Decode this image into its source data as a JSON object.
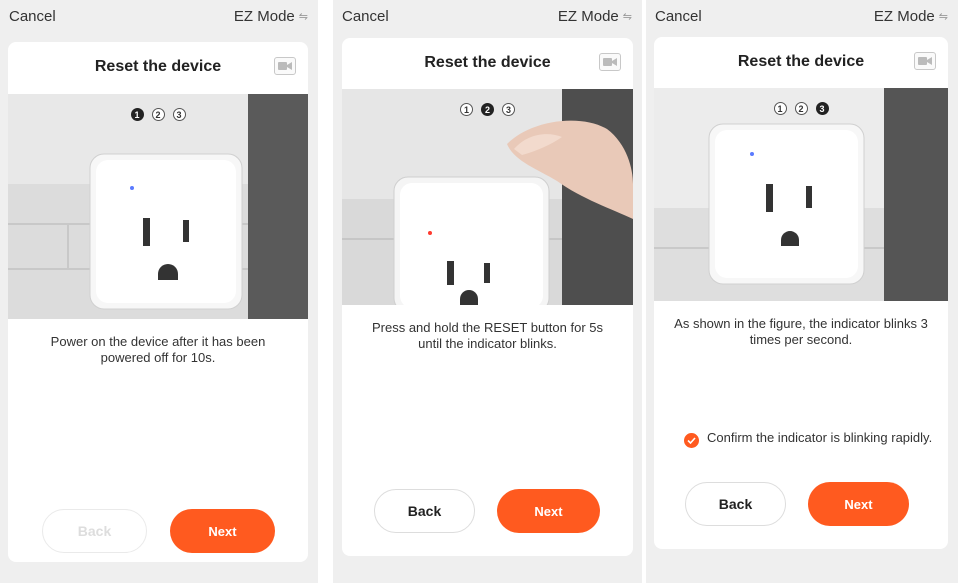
{
  "screens": [
    {
      "cancel_label": "Cancel",
      "mode_label": "EZ Mode",
      "title": "Reset the device",
      "steps": [
        "1",
        "2",
        "3"
      ],
      "active_step": 1,
      "description": "Power on the device after it has been powered off for 10s.",
      "back_label": "Back",
      "back_disabled": true,
      "next_label": "Next"
    },
    {
      "cancel_label": "Cancel",
      "mode_label": "EZ Mode",
      "title": "Reset the device",
      "steps": [
        "1",
        "2",
        "3"
      ],
      "active_step": 2,
      "description": "Press and hold the RESET button for 5s until the indicator blinks.",
      "back_label": "Back",
      "back_disabled": false,
      "next_label": "Next"
    },
    {
      "cancel_label": "Cancel",
      "mode_label": "EZ Mode",
      "title": "Reset the device",
      "steps": [
        "1",
        "2",
        "3"
      ],
      "active_step": 3,
      "description": "As shown in the figure, the indicator blinks 3 times per second.",
      "confirm_label": "Confirm the indicator is blinking rapidly.",
      "confirm_checked": true,
      "back_label": "Back",
      "back_disabled": false,
      "next_label": "Next"
    }
  ],
  "icons": {
    "swap": "swap-arrows-icon",
    "video": "video-camera-icon",
    "check": "checkmark-icon"
  },
  "colors": {
    "accent": "#ff5a1f",
    "indicator_blue": "#5b7bff",
    "indicator_red": "#ff3b2f",
    "background": "#efefef",
    "card": "#ffffff"
  }
}
